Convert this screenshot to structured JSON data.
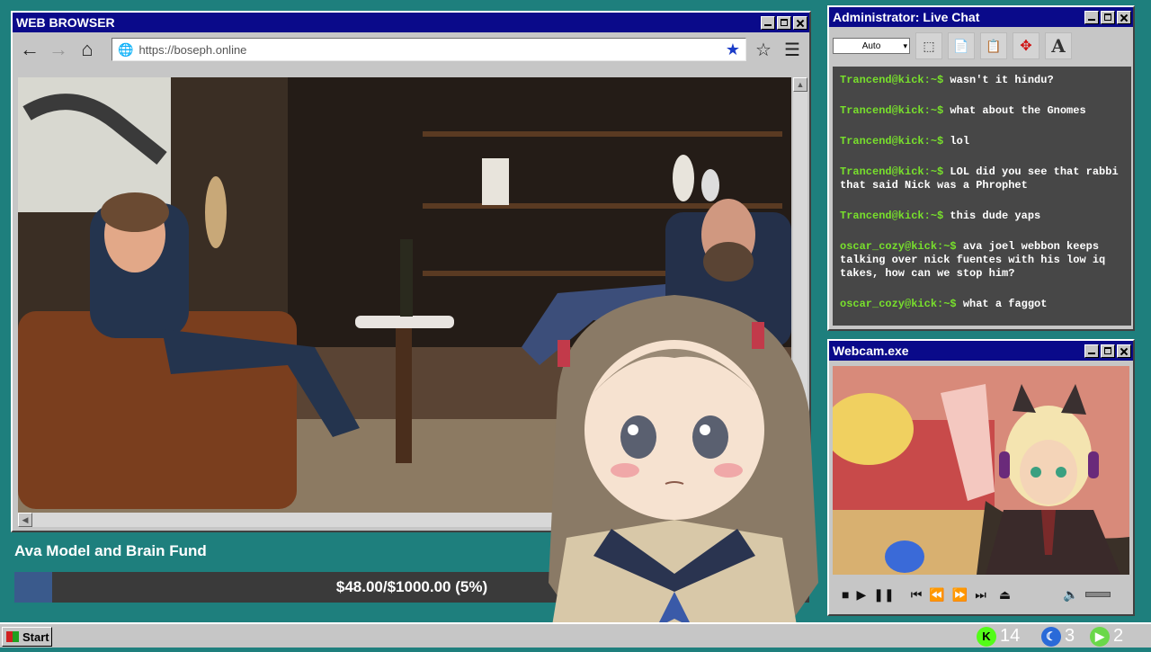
{
  "browser": {
    "title": "WEB BROWSER",
    "url": "https://boseph.online"
  },
  "chat": {
    "title": "Administrator: Live Chat",
    "font_size_select": "Auto",
    "messages": [
      {
        "user": "Trancend@kick:~$",
        "text": "wasn't it hindu?"
      },
      {
        "user": "Trancend@kick:~$",
        "text": "what about the Gnomes"
      },
      {
        "user": "Trancend@kick:~$",
        "text": "lol"
      },
      {
        "user": "Trancend@kick:~$",
        "text": "LOL did you see that rabbi that said Nick was a Phrophet"
      },
      {
        "user": "Trancend@kick:~$",
        "text": "this dude yaps"
      },
      {
        "user": "oscar_cozy@kick:~$",
        "text": "ava joel webbon keeps talking over nick fuentes with his low iq takes, how can we stop him?"
      },
      {
        "user": "oscar_cozy@kick:~$",
        "text": "what a faggot"
      }
    ]
  },
  "webcam": {
    "title": "Webcam.exe"
  },
  "fund": {
    "title": "Ava Model and Brain Fund",
    "amount_text": "$48.00/$1000.00 (5%)",
    "progress_fraction": 0.048
  },
  "taskbar": {
    "start_label": "Start",
    "tray": [
      {
        "icon": "kick-icon",
        "value": "14",
        "color": "#53fc18"
      },
      {
        "icon": "moon-icon",
        "value": "3",
        "color": "#2a6ad8"
      },
      {
        "icon": "play-icon",
        "value": "2",
        "color": "#6ad84a"
      }
    ]
  },
  "colors": {
    "desktop": "#1e7f7d",
    "titlebar": "#0a0a8a",
    "chat_user": "#78e02c"
  }
}
